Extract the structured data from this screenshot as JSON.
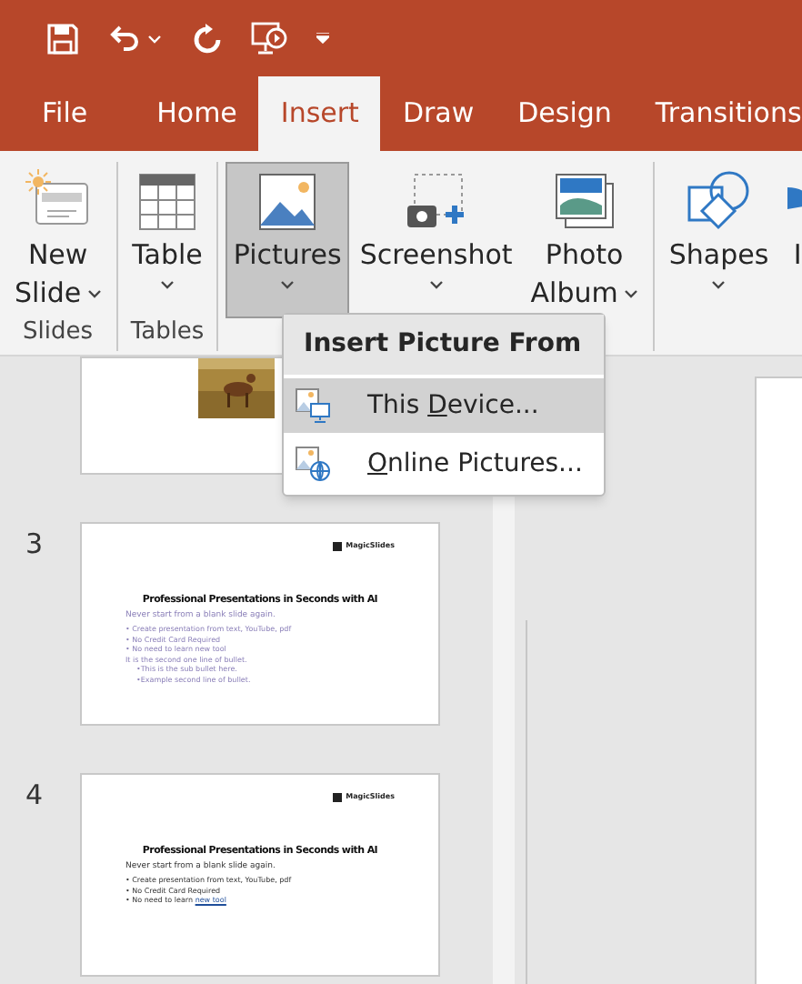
{
  "tabs": [
    {
      "label": "File",
      "selected": false
    },
    {
      "label": "Home",
      "selected": false
    },
    {
      "label": "Insert",
      "selected": true
    },
    {
      "label": "Draw",
      "selected": false
    },
    {
      "label": "Design",
      "selected": false
    },
    {
      "label": "Transitions",
      "selected": false
    }
  ],
  "ribbon_groups": [
    {
      "label": "Slides",
      "buttons": [
        {
          "kind": "new-slide",
          "lines": [
            "New",
            "Slide"
          ],
          "dropdown": true,
          "selected": false
        }
      ]
    },
    {
      "label": "Tables",
      "buttons": [
        {
          "kind": "table",
          "lines": [
            "Table"
          ],
          "dropdown": true,
          "selected": false
        }
      ]
    },
    {
      "buttons": [
        {
          "kind": "pictures",
          "lines": [
            "Pictures"
          ],
          "dropdown": true,
          "selected": true
        },
        {
          "kind": "screenshot",
          "lines": [
            "Screenshot"
          ],
          "dropdown": true,
          "selected": false
        },
        {
          "kind": "album",
          "lines": [
            "Photo",
            "Album"
          ],
          "dropdown": true,
          "selected": false
        }
      ]
    },
    {
      "buttons": [
        {
          "kind": "shapes",
          "lines": [
            "Shapes"
          ],
          "dropdown": true,
          "selected": false
        },
        {
          "kind": "icons",
          "lines": [
            "I"
          ],
          "dropdown": false,
          "selected": false
        }
      ]
    }
  ],
  "menu": {
    "title": "Insert Picture From",
    "items": [
      {
        "kind": "device",
        "before": "This ",
        "key": "D",
        "after": "evice...",
        "selected": true
      },
      {
        "kind": "online",
        "key": "O",
        "after": "nline Pictures...",
        "selected": false
      }
    ]
  },
  "slides": [
    {
      "kind": "picture"
    },
    {
      "kind": "text",
      "number": "3",
      "logo": "MagicSlides",
      "title": "Professional Presentations in Seconds with AI",
      "subtitle": "Never start from a blank slide again.",
      "faded": true,
      "bullets": [
        {
          "text": "• Create presentation from text, YouTube, pdf"
        },
        {
          "text": "• No Credit Card Required"
        },
        {
          "text": "• No need to learn new tool"
        },
        {
          "text": "It is the second one line of bullet."
        },
        {
          "text": "•This is the sub bullet here.",
          "sub": true
        },
        {
          "text": "•Example second line of bullet.",
          "sub": true
        }
      ]
    },
    {
      "kind": "text",
      "number": "4",
      "logo": "MagicSlides",
      "title": "Professional Presentations in Seconds with AI",
      "subtitle": "Never start from a blank slide again.",
      "faded": false,
      "bullets": [
        {
          "text": "• Create presentation from text, YouTube, pdf"
        },
        {
          "text": "• No Credit Card Required"
        },
        {
          "text": "• No need to learn ",
          "link": "new tool"
        }
      ]
    }
  ]
}
